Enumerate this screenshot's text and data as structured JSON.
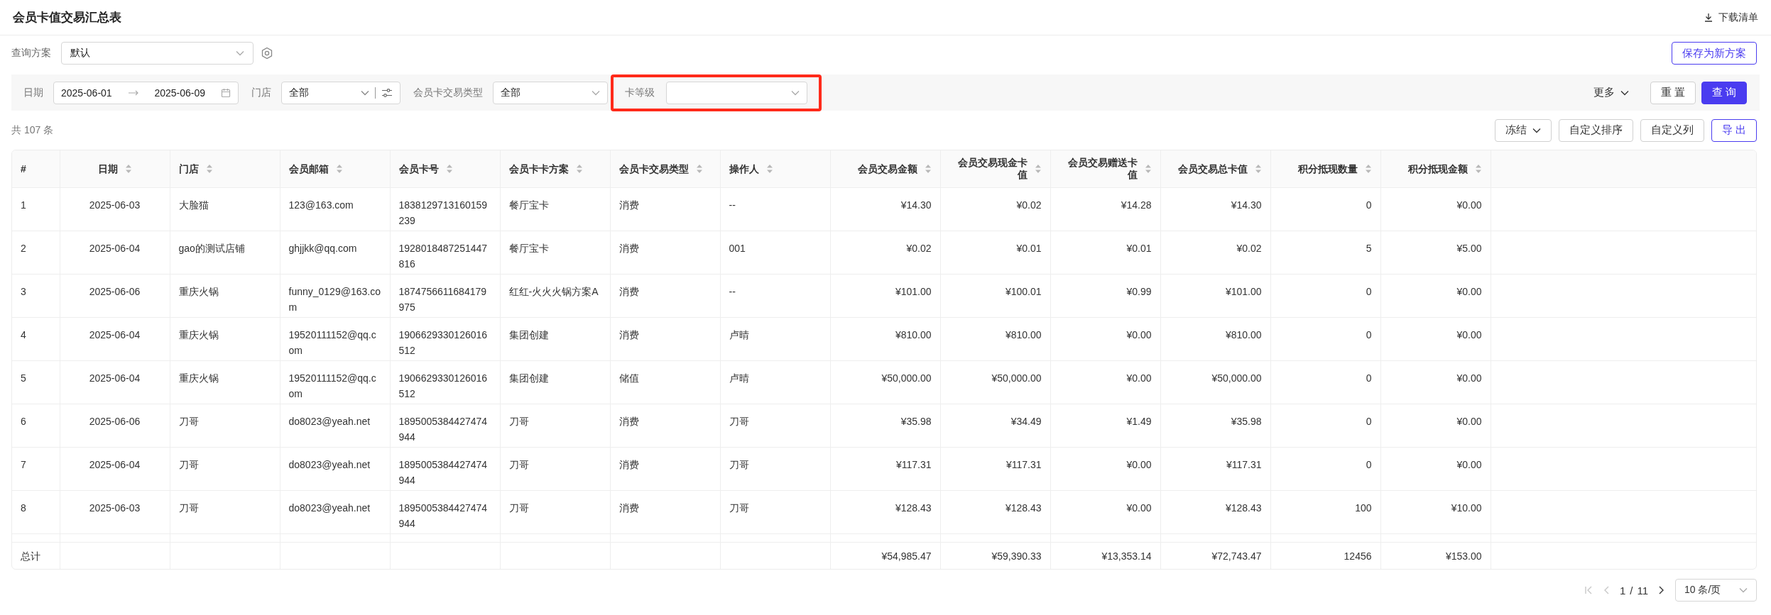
{
  "title": "会员卡值交易汇总表",
  "download_button": "下载清单",
  "query_scheme": {
    "label": "查询方案",
    "value": "默认"
  },
  "save_button": "保存为新方案",
  "filters": [
    {
      "kind": "daterange",
      "label": "日期",
      "start": "2025-06-01",
      "end": "2025-06-09",
      "highlighted": false
    },
    {
      "kind": "select-config",
      "label": "门店",
      "value": "全部",
      "highlighted": false
    },
    {
      "kind": "select",
      "label": "会员卡交易类型",
      "value": "全部",
      "highlighted": false
    },
    {
      "kind": "select",
      "label": "卡等级",
      "highlighted": true
    }
  ],
  "more_button": "更多",
  "reset_button": "重 置",
  "search_button": "查 询",
  "total_count": "共 107 条",
  "table_buttons": [
    {
      "kind": "dropdown",
      "label": "冻结"
    },
    {
      "kind": "plain",
      "label": "自定义排序"
    },
    {
      "kind": "plain",
      "label": "自定义列"
    },
    {
      "kind": "primary-outline",
      "label": "导 出"
    }
  ],
  "table": {
    "columns": [
      {
        "label": "#",
        "kind": "index",
        "sortable": false
      },
      {
        "label": "日期",
        "kind": "date",
        "sortable": true
      },
      {
        "label": "门店",
        "kind": "text",
        "sortable": true
      },
      {
        "label": "会员邮箱",
        "kind": "text",
        "sortable": true
      },
      {
        "label": "会员卡号",
        "kind": "text",
        "sortable": true
      },
      {
        "label": "会员卡卡方案",
        "kind": "text",
        "sortable": true
      },
      {
        "label": "会员卡交易类型",
        "kind": "text",
        "sortable": true
      },
      {
        "label": "操作人",
        "kind": "text",
        "sortable": true
      },
      {
        "label": "会员交易金额",
        "kind": "number",
        "sortable": true
      },
      {
        "label": "会员交易现金卡值",
        "kind": "number",
        "sortable": true
      },
      {
        "label": "会员交易赠送卡值",
        "kind": "number",
        "sortable": true
      },
      {
        "label": "会员交易总卡值",
        "kind": "number",
        "sortable": true
      },
      {
        "label": "积分抵现数量",
        "kind": "number",
        "sortable": true
      },
      {
        "label": "积分抵现金额",
        "kind": "number",
        "sortable": true
      }
    ],
    "rows": [
      [
        "1",
        "2025-06-03",
        "大脸猫",
        "123@163.com",
        "1838129713160159239",
        "餐厅宝卡",
        "消费",
        "--",
        "¥14.30",
        "¥0.02",
        "¥14.28",
        "¥14.30",
        "0",
        "¥0.00"
      ],
      [
        "2",
        "2025-06-04",
        "gao的测试店铺",
        "ghjjkk@qq.com",
        "1928018487251447816",
        "餐厅宝卡",
        "消费",
        "001",
        "¥0.02",
        "¥0.01",
        "¥0.01",
        "¥0.02",
        "5",
        "¥5.00"
      ],
      [
        "3",
        "2025-06-06",
        "重庆火锅",
        "funny_0129@163.com",
        "1874756611684179975",
        "红红-火火火锅方案A",
        "消费",
        "--",
        "¥101.00",
        "¥100.01",
        "¥0.99",
        "¥101.00",
        "0",
        "¥0.00"
      ],
      [
        "4",
        "2025-06-04",
        "重庆火锅",
        "19520111152@qq.com",
        "1906629330126016512",
        "集团创建",
        "消费",
        "卢晴",
        "¥810.00",
        "¥810.00",
        "¥0.00",
        "¥810.00",
        "0",
        "¥0.00"
      ],
      [
        "5",
        "2025-06-04",
        "重庆火锅",
        "19520111152@qq.com",
        "1906629330126016512",
        "集团创建",
        "储值",
        "卢晴",
        "¥50,000.00",
        "¥50,000.00",
        "¥0.00",
        "¥50,000.00",
        "0",
        "¥0.00"
      ],
      [
        "6",
        "2025-06-06",
        "刀哥",
        "do8023@yeah.net",
        "1895005384427474944",
        "刀哥",
        "消费",
        "刀哥",
        "¥35.98",
        "¥34.49",
        "¥1.49",
        "¥35.98",
        "0",
        "¥0.00"
      ],
      [
        "7",
        "2025-06-04",
        "刀哥",
        "do8023@yeah.net",
        "1895005384427474944",
        "刀哥",
        "消费",
        "刀哥",
        "¥117.31",
        "¥117.31",
        "¥0.00",
        "¥117.31",
        "0",
        "¥0.00"
      ],
      [
        "8",
        "2025-06-03",
        "刀哥",
        "do8023@yeah.net",
        "1895005384427474944",
        "刀哥",
        "消费",
        "刀哥",
        "¥128.43",
        "¥128.43",
        "¥0.00",
        "¥128.43",
        "100",
        "¥10.00"
      ]
    ],
    "summary": {
      "label": "总计",
      "totals": [
        "¥54,985.47",
        "¥59,390.33",
        "¥13,353.14",
        "¥72,743.47",
        "12456",
        "¥153.00"
      ]
    }
  },
  "pagination": {
    "first_disabled": true,
    "prev_disabled": true,
    "next_disabled": false,
    "current": "1",
    "separator": "/",
    "total": "11",
    "page_size": "10 条/页"
  }
}
